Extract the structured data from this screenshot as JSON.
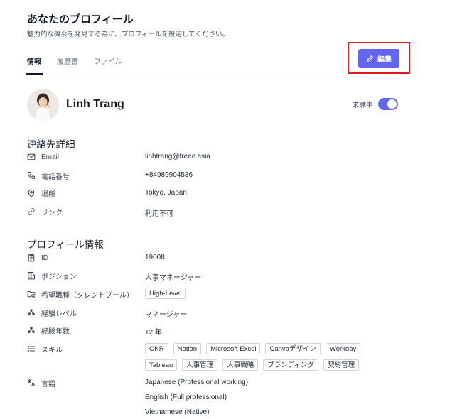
{
  "header": {
    "title": "あなたのプロフィール",
    "subtitle": "魅力的な機会を発見する為に、プロフィールを設定してください。"
  },
  "tabs": [
    {
      "label": "情報",
      "active": true
    },
    {
      "label": "履歴書",
      "active": false
    },
    {
      "label": "ファイル",
      "active": false
    }
  ],
  "edit_button": {
    "label": "編集",
    "icon": "pencil-icon",
    "color": "#6366f1",
    "highlight_color": "#e11d1d"
  },
  "user": {
    "name": "Linh Trang",
    "job_seeking_label": "求職中",
    "job_seeking_enabled": true,
    "toggle_color": "#6366f1"
  },
  "contact": {
    "title": "連絡先詳細",
    "items": [
      {
        "label": "Email",
        "value": "linhtrang@freec.asia",
        "icon": "mail-icon"
      },
      {
        "label": "電話番号",
        "value": "+84989904536",
        "icon": "phone-icon"
      },
      {
        "label": "場所",
        "value": "Tokyo, Japan",
        "icon": "location-pin-icon"
      },
      {
        "label": "リンク",
        "value": "利用不可",
        "icon": "link-icon"
      }
    ]
  },
  "profile": {
    "title": "プロフィール情報",
    "id": {
      "label": "ID",
      "value": "19008",
      "icon": "clipboard-icon"
    },
    "position": {
      "label": "ポジション",
      "value": "人事マネージャー",
      "icon": "building-icon"
    },
    "desired_job": {
      "label": "希望職種（タレントプール）",
      "tag": "High-Level",
      "icon": "folder-search-icon"
    },
    "experience_level": {
      "label": "経験レベル",
      "value": "マネージャー",
      "icon": "hierarchy-icon"
    },
    "experience_years": {
      "label": "経験年数",
      "value": "12 年",
      "icon": "hierarchy-icon"
    },
    "skills": {
      "label": "スキル",
      "icon": "list-icon",
      "items": [
        "OKR",
        "Notion",
        "Microsoft Excel",
        "Canvaデザイン",
        "Workday",
        "Tableau",
        "人事管理",
        "人事戦略",
        "ブランディング",
        "契約管理"
      ]
    },
    "languages": {
      "label": "言語",
      "icon": "translate-icon",
      "items": [
        "Japanese (Professional working)",
        "English (Full professional)",
        "Vietnamese (Native)"
      ]
    }
  }
}
